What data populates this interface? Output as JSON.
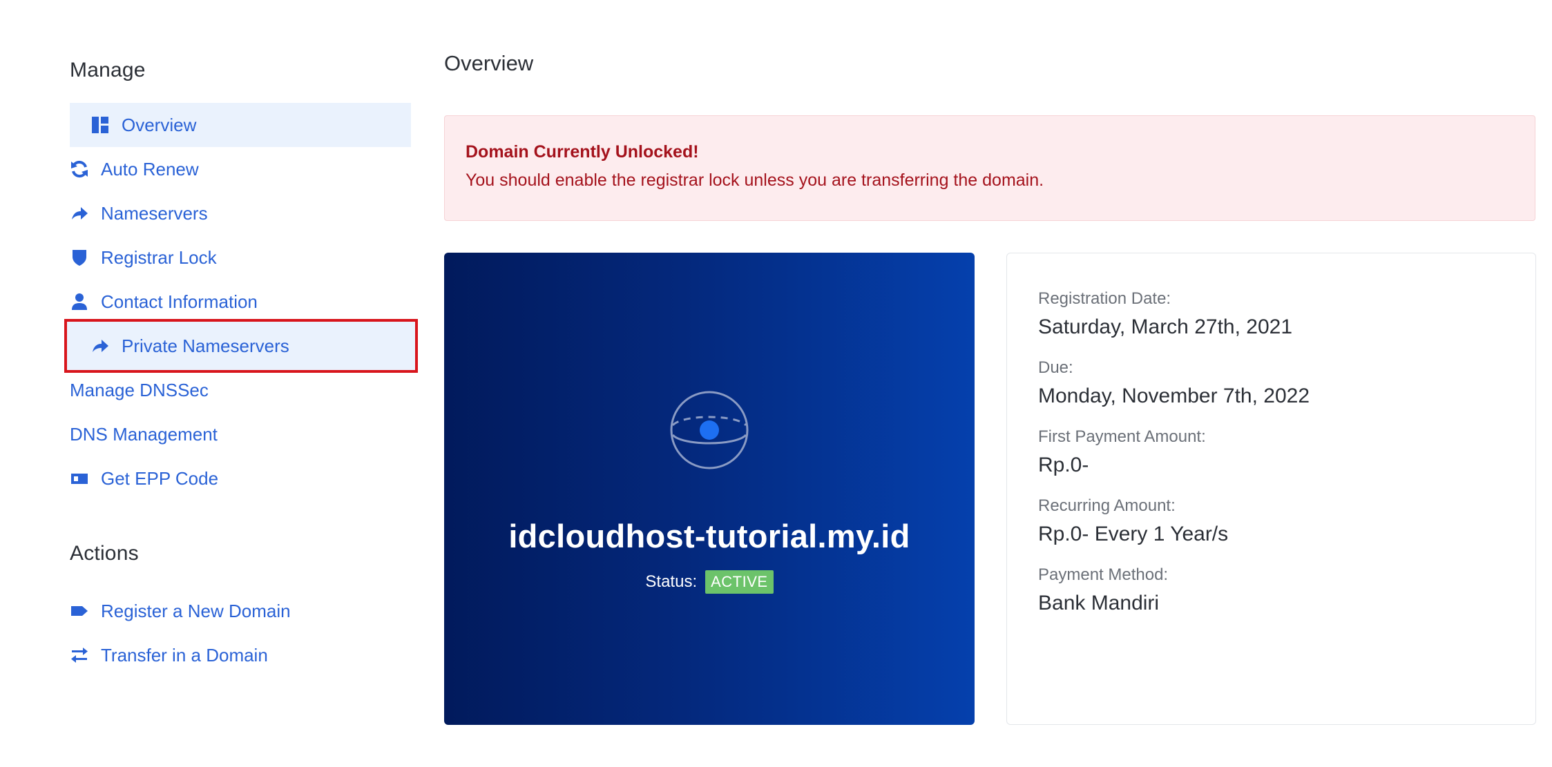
{
  "sidebar": {
    "manage_title": "Manage",
    "manage_items": [
      {
        "label": "Overview",
        "icon": "dashboard-icon"
      },
      {
        "label": "Auto Renew",
        "icon": "refresh-icon"
      },
      {
        "label": "Nameservers",
        "icon": "share-arrow-icon"
      },
      {
        "label": "Registrar Lock",
        "icon": "shield-icon"
      },
      {
        "label": "Contact Information",
        "icon": "user-icon"
      },
      {
        "label": "Private Nameservers",
        "icon": "share-arrow-icon"
      },
      {
        "label": "Manage DNSSec"
      },
      {
        "label": "DNS Management"
      },
      {
        "label": "Get EPP Code",
        "icon": "id-card-icon"
      }
    ],
    "actions_title": "Actions",
    "action_items": [
      {
        "label": "Register a New Domain",
        "icon": "tag-icon"
      },
      {
        "label": "Transfer in a Domain",
        "icon": "exchange-icon"
      }
    ]
  },
  "main": {
    "title": "Overview",
    "alert": {
      "title": "Domain Currently Unlocked!",
      "text": "You should enable the registrar lock unless you are transferring the domain."
    },
    "domain_card": {
      "icon": "globe-icon",
      "domain": "idcloudhost-tutorial.my.id",
      "status_label": "Status:",
      "status_value": "ACTIVE"
    },
    "info": [
      {
        "label": "Registration Date:",
        "value": "Saturday, March 27th, 2021"
      },
      {
        "label": "Due:",
        "value": "Monday, November 7th, 2022"
      },
      {
        "label": "First Payment Amount:",
        "value": "Rp.0-"
      },
      {
        "label": "Recurring Amount:",
        "value": "Rp.0- Every 1 Year/s"
      },
      {
        "label": "Payment Method:",
        "value": "Bank Mandiri"
      }
    ]
  },
  "colors": {
    "link": "#2a62d6",
    "active_bg": "#eaf2fd",
    "highlight_border": "#d8151c",
    "alert_bg": "#fdecee",
    "alert_text": "#a4121c",
    "status_active": "#6cc36a",
    "card_dark": "#011a5c",
    "card_light": "#0540ad"
  }
}
